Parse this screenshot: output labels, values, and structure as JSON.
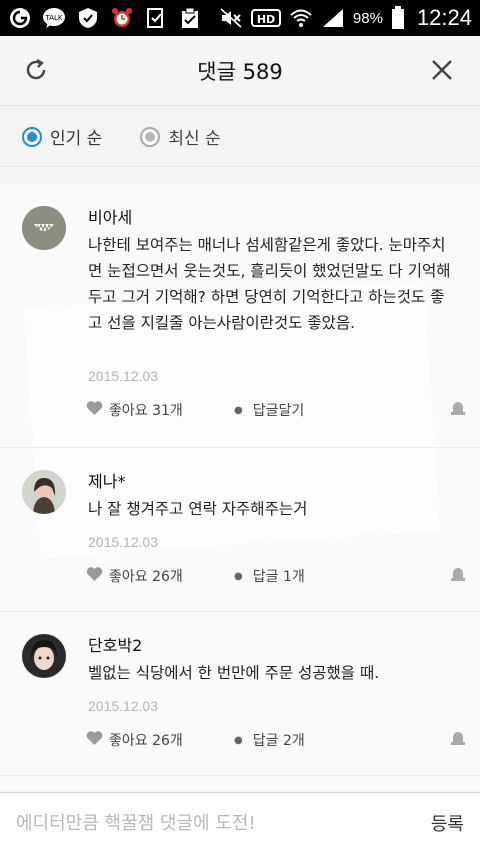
{
  "status_bar": {
    "battery": "98%",
    "time": "12:24",
    "icons_left": [
      "talk-icon",
      "kakaotalk-icon",
      "shield-icon",
      "alarm-icon",
      "download-icon",
      "clipboard-icon"
    ],
    "icons_right": [
      "mute-icon",
      "hd-icon",
      "wifi-icon",
      "signal-icon",
      "battery-icon"
    ]
  },
  "header": {
    "title": "댓글 589",
    "refresh_icon": "refresh-icon",
    "close_icon": "close-icon"
  },
  "sort": {
    "options": [
      {
        "label": "인기 순",
        "selected": true
      },
      {
        "label": "최신 순",
        "selected": false
      }
    ]
  },
  "comments": [
    {
      "author": "비아세",
      "text": "나한테 보여주는 매너나 섬세함같은게 좋았다. 눈마주치면 눈접으면서 웃는것도, 흘리듯이 했었던말도 다 기억해두고 그거 기억해? 하면 당연히 기억한다고 하는것도 좋고 선을 지킬줄 아는사람이란것도 좋았음.",
      "date": "2015.12.03",
      "likes": "좋아요 31개",
      "reply": "답글달기"
    },
    {
      "author": "제나*",
      "text": "나 잘 챙겨주고 연락 자주해주는거",
      "date": "2015.12.03",
      "likes": "좋아요 26개",
      "reply": "답글 1개"
    },
    {
      "author": "단호박2",
      "text": "벨없는 식당에서 한 번만에 주문 성공했을 때.",
      "date": "2015.12.03",
      "likes": "좋아요 26개",
      "reply": "답글 2개"
    }
  ],
  "input": {
    "placeholder": "에디터만큼 핵꿀잼 댓글에 도전!",
    "submit_label": "등록"
  },
  "colors": {
    "accent": "#1e90d8",
    "date": "#b5b5b5"
  }
}
